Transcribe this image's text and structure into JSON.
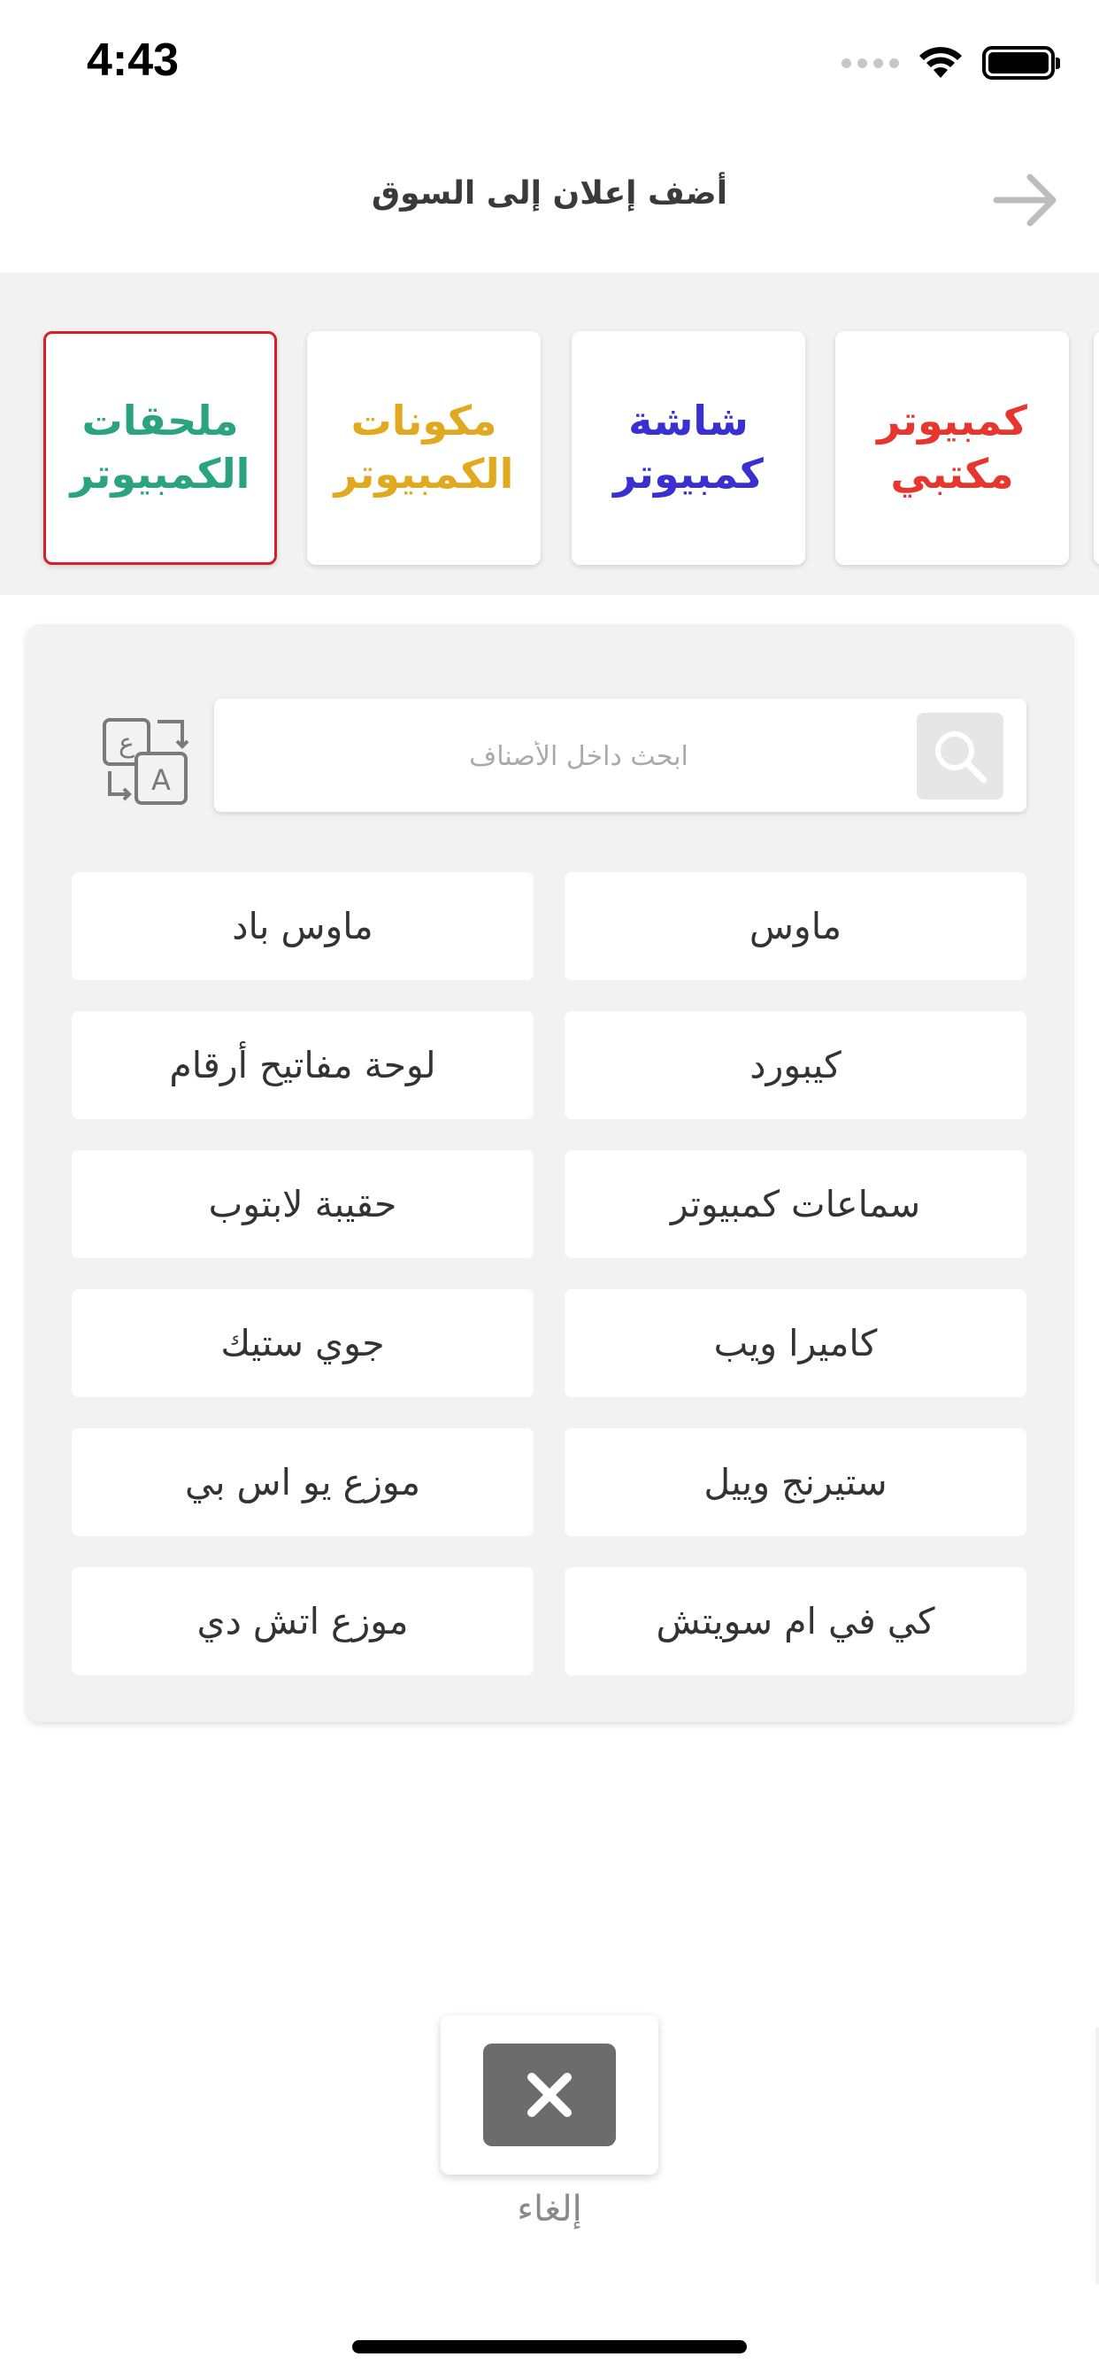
{
  "status_bar": {
    "time": "4:43"
  },
  "header": {
    "title": "أضف إعلان إلى السوق",
    "back_icon": "arrow-right-icon"
  },
  "categories": [
    {
      "label": "كمبيوتر مكتبي",
      "color": "#e8352e",
      "selected": false
    },
    {
      "label": "شاشة كمبيوتر",
      "color": "#3a2fd0",
      "selected": false
    },
    {
      "label": "مكونات الكمبيوتر",
      "color": "#e0a91f",
      "selected": false
    },
    {
      "label": "ملحقات الكمبيوتر",
      "color": "#2aa37f",
      "selected": true
    }
  ],
  "search": {
    "placeholder": "ابحث داخل الأصناف",
    "icon": "search-icon",
    "translate_icon": "translate-icon"
  },
  "subcategories": [
    "ماوس",
    "ماوس باد",
    "كيبورد",
    "لوحة مفاتيح أرقام",
    "سماعات كمبيوتر",
    "حقيبة لابتوب",
    "كاميرا ويب",
    "جوي ستيك",
    "ستيرنج وييل",
    "موزع يو اس بي",
    "كي في ام سويتش",
    "موزع اتش دي"
  ],
  "cancel": {
    "label": "إلغاء",
    "icon": "close-icon"
  },
  "colors": {
    "selected_border": "#d61f26",
    "background": "#f2f2f2",
    "cancel_button": "#6c6c6c"
  }
}
